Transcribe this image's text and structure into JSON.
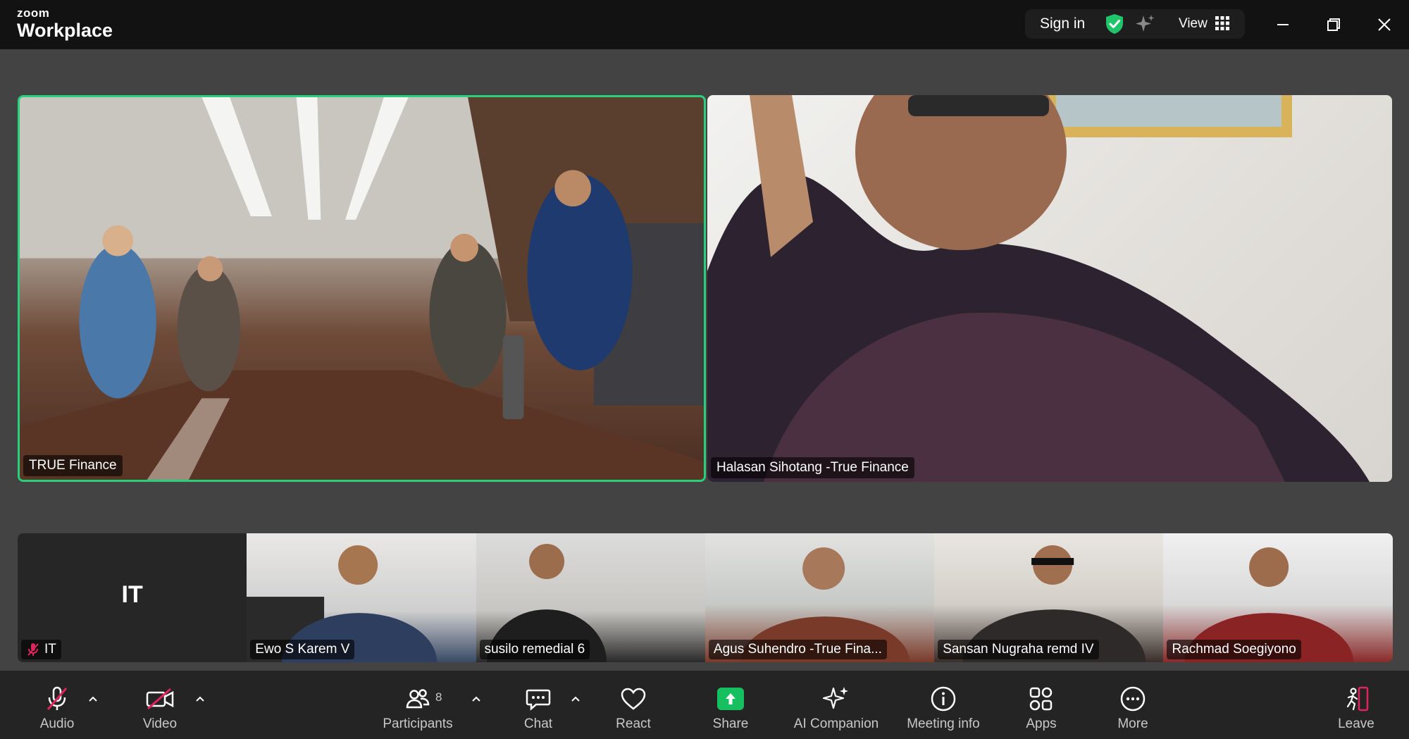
{
  "app": {
    "logo_top": "zoom",
    "logo_bottom": "Workplace"
  },
  "titlebar": {
    "signin_label": "Sign in",
    "view_label": "View"
  },
  "main_tiles": [
    {
      "name": "TRUE Finance",
      "active_speaker": true
    },
    {
      "name": "Halasan Sihotang -True Finance",
      "active_speaker": false
    }
  ],
  "thumbnails": [
    {
      "initial": "IT",
      "name": "IT",
      "muted": true
    },
    {
      "name": "Ewo S Karem V"
    },
    {
      "name": "susilo remedial 6"
    },
    {
      "name": "Agus Suhendro -True Fina..."
    },
    {
      "name": "Sansan Nugraha remd IV"
    },
    {
      "name": "Rachmad Soegiyono"
    }
  ],
  "toolbar": {
    "audio": "Audio",
    "video": "Video",
    "participants": "Participants",
    "participants_count": "8",
    "chat": "Chat",
    "react": "React",
    "share": "Share",
    "ai_companion": "AI Companion",
    "meeting_info": "Meeting info",
    "apps": "Apps",
    "more": "More",
    "leave": "Leave"
  },
  "colors": {
    "active_border": "#26d07c",
    "share_green": "#16c060",
    "muted_red": "#e0245e",
    "leave_red": "#e0245e"
  }
}
